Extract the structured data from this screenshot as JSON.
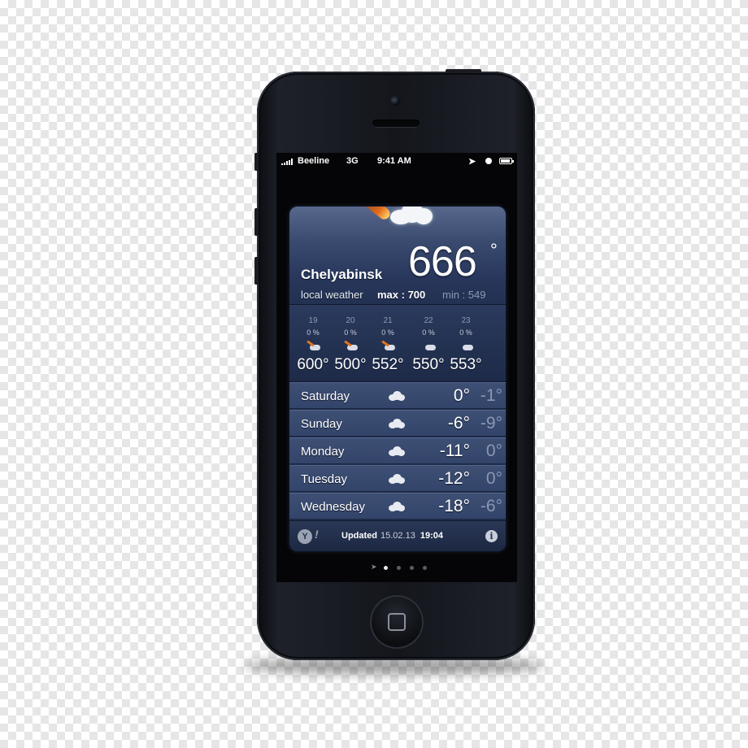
{
  "status_bar": {
    "carrier": "Beeline",
    "network": "3G",
    "time": "9:41 AM",
    "icons": [
      "signal-icon",
      "location-icon",
      "alarm-icon",
      "battery-icon"
    ]
  },
  "weather": {
    "city": "Chelyabinsk",
    "subtitle": "local weather",
    "current_temp": "666",
    "degree_symbol": "°",
    "max_label": "max : 700",
    "min_label": "min : 549",
    "hourly": [
      {
        "hour": "19",
        "chance": "0 %",
        "temp": "600°"
      },
      {
        "hour": "20",
        "chance": "0 %",
        "temp": "500°"
      },
      {
        "hour": "21",
        "chance": "0 %",
        "temp": "552°"
      },
      {
        "hour": "22",
        "chance": "0 %",
        "temp": "550°"
      },
      {
        "hour": "23",
        "chance": "0 %",
        "temp": "553°"
      }
    ],
    "daily": [
      {
        "day": "Saturday",
        "high": "0°",
        "low": "-1°"
      },
      {
        "day": "Sunday",
        "high": "-6°",
        "low": "-9°"
      },
      {
        "day": "Monday",
        "high": "-11°",
        "low": "0°"
      },
      {
        "day": "Tuesday",
        "high": "-12°",
        "low": "0°"
      },
      {
        "day": "Wednesday",
        "high": "-18°",
        "low": "-6°"
      }
    ],
    "footer": {
      "logo_letter": "Y",
      "logo_bang": "!",
      "updated_label": "Updated",
      "date": "15.02.13",
      "time": "19:04",
      "info_glyph": "i"
    }
  },
  "page_indicator": {
    "pages": 4,
    "active_index": 0
  },
  "colors": {
    "widget_bg": "#243351",
    "meteor": "#e36a1c",
    "low_temp": "#8a97b1"
  }
}
